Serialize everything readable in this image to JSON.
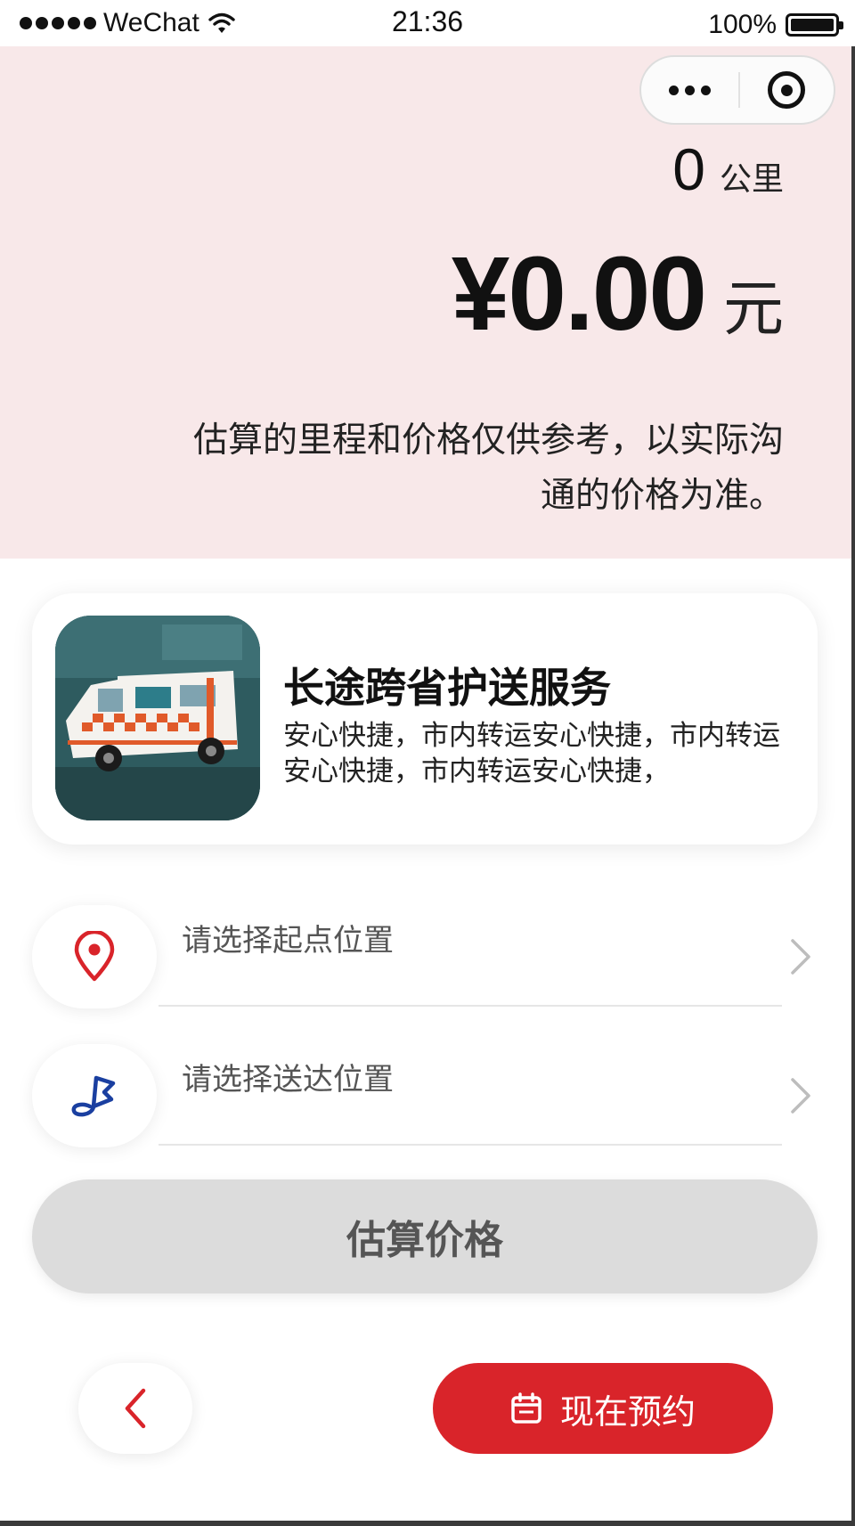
{
  "status_bar": {
    "carrier": "WeChat",
    "time": "21:36",
    "battery": "100%",
    "battery_level": 1.0
  },
  "summary": {
    "distance_value": "0",
    "distance_unit": "公里",
    "price_value": "¥0.00",
    "price_unit": "元",
    "disclaimer_line1": "估算的里程和价格仅供参考，以实际沟",
    "disclaimer_line2": "通的价格为准。"
  },
  "service": {
    "title": "长途跨省护送服务",
    "description": "安心快捷，市内转运安心快捷，市内转运安心快捷，市内转运安心快捷，"
  },
  "locations": {
    "start_placeholder": "请选择起点位置",
    "destination_placeholder": "请选择送达位置"
  },
  "actions": {
    "estimate_label": "估算价格",
    "book_label": "现在预约"
  },
  "colors": {
    "accent": "#d9242a",
    "summary_bg": "#f8e8e9",
    "flag_icon": "#1a3fa0"
  },
  "icons": {
    "start": "map-pin-icon",
    "destination": "flag-icon",
    "back": "chevron-left-icon",
    "book": "calendar-icon",
    "row_arrow": "chevron-right-icon"
  }
}
